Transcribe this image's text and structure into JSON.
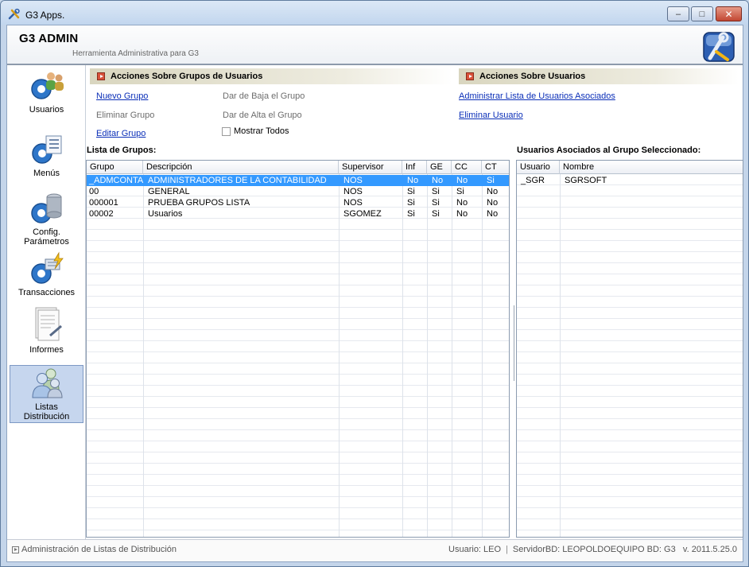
{
  "window": {
    "title": "G3 Apps.",
    "controls": {
      "minimize": "–",
      "maximize": "□",
      "close": "✕"
    }
  },
  "header": {
    "app_name": "G3 ADMIN",
    "subtitle": "Herramienta Administrativa para G3"
  },
  "sidebar": {
    "items": [
      {
        "label": "Usuarios",
        "icon": "users-gear-icon",
        "selected": false
      },
      {
        "label": "Menús",
        "icon": "menu-gear-icon",
        "selected": false
      },
      {
        "label": "Config.",
        "label2": "Parámetros",
        "icon": "database-gear-icon",
        "selected": false
      },
      {
        "label": "Transacciones",
        "icon": "transactions-gear-icon",
        "selected": false
      },
      {
        "label": "Informes",
        "icon": "report-icon",
        "selected": false
      },
      {
        "label": "Listas",
        "label2": "Distribución",
        "icon": "distribution-users-icon",
        "selected": true
      }
    ]
  },
  "actions_groups": {
    "title": "Acciones Sobre Grupos de Usuarios",
    "new_group": "Nuevo Grupo",
    "delete_group": "Eliminar Grupo",
    "edit_group": "Editar Grupo",
    "deactivate_group": "Dar de Baja el Grupo",
    "activate_group": "Dar de Alta el Grupo",
    "show_all": "Mostrar Todos"
  },
  "actions_users": {
    "title": "Acciones Sobre Usuarios",
    "manage_users": "Administrar Lista de Usuarios Asociados",
    "delete_user": "Eliminar Usuario"
  },
  "groups": {
    "title": "Lista de Grupos:",
    "columns": [
      "Grupo",
      "Descripción",
      "Supervisor",
      "Inf",
      "GE",
      "CC",
      "CT"
    ],
    "rows": [
      [
        "_ADMCONTA",
        "ADMINISTRADORES DE LA CONTABILIDAD",
        "NOS",
        "No",
        "No",
        "No",
        "Si"
      ],
      [
        "00",
        "GENERAL",
        "NOS",
        "Si",
        "Si",
        "Si",
        "No"
      ],
      [
        "000001",
        "PRUEBA GRUPOS LISTA",
        "NOS",
        "Si",
        "Si",
        "No",
        "No"
      ],
      [
        "00002",
        "Usuarios",
        "SGOMEZ",
        "Si",
        "Si",
        "No",
        "No"
      ]
    ],
    "selected_row": 0
  },
  "users": {
    "title": "Usuarios Asociados al Grupo Seleccionado:",
    "columns": [
      "Usuario",
      "Nombre"
    ],
    "rows": [
      [
        "_SGR",
        "SGRSOFT"
      ]
    ]
  },
  "statusbar": {
    "left": "Administración de Listas de Distribución",
    "user": "Usuario: LEO",
    "server": "ServidorBD: LEOPOLDOEQUIPO",
    "db": "BD: G3",
    "version": "v. 2011.5.25.0"
  }
}
